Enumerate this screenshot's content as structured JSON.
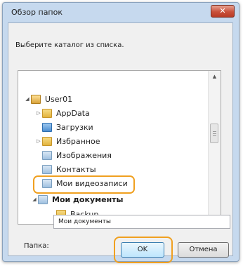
{
  "window": {
    "title": "Обзор папок",
    "close_label": "✕"
  },
  "prompt": "Выберите каталог из списка.",
  "tree": {
    "items": [
      {
        "label": "User01",
        "expander": "◢",
        "icon": "user-folder-icon"
      },
      {
        "label": "AppData",
        "expander": "▷",
        "icon": "folder-icon"
      },
      {
        "label": "Загрузки",
        "expander": "",
        "icon": "downloads-folder-icon"
      },
      {
        "label": "Избранное",
        "expander": "▷",
        "icon": "favorites-folder-icon"
      },
      {
        "label": "Изображения",
        "expander": "",
        "icon": "pictures-folder-icon"
      },
      {
        "label": "Контакты",
        "expander": "",
        "icon": "contacts-folder-icon"
      },
      {
        "label": "Мои видеозаписи",
        "expander": "",
        "icon": "videos-folder-icon"
      },
      {
        "label": "Мои документы",
        "expander": "◢",
        "icon": "documents-folder-icon"
      },
      {
        "label": "Backup",
        "expander": "",
        "icon": "folder-icon"
      }
    ],
    "scroll_up": "▲",
    "scroll_down": "▼"
  },
  "folder_field": {
    "label": "Папка:",
    "value": "Мои документы"
  },
  "buttons": {
    "ok": "OK",
    "cancel": "Отмена"
  },
  "colors": {
    "highlight": "#f0a020",
    "selection": "#e5f3ff"
  }
}
